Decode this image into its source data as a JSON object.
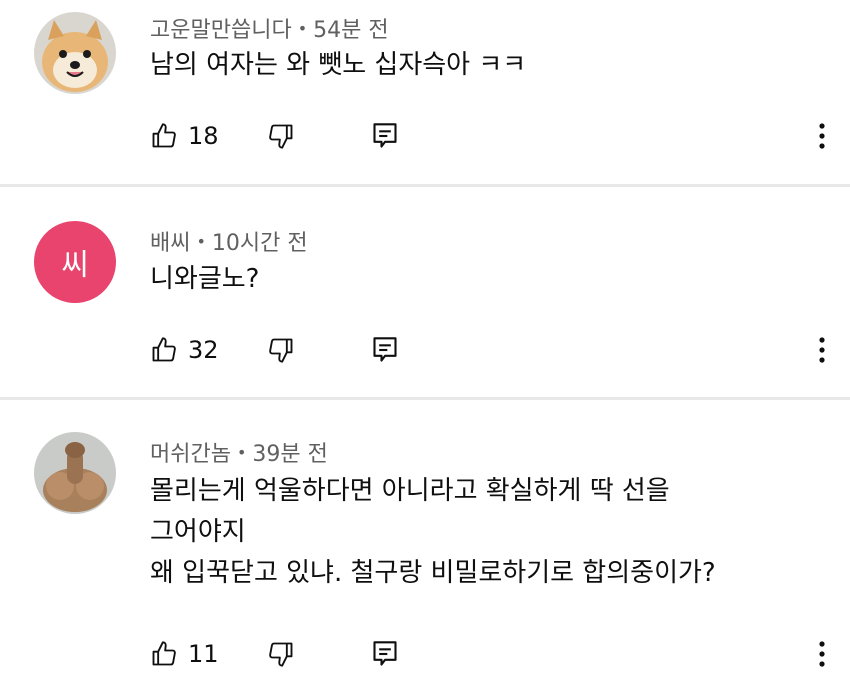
{
  "comments": [
    {
      "author": "고운말만씁니다",
      "time": "54분 전",
      "lines": [
        "남의 여자는 와 뺏노 십자슥아 ㅋㅋ"
      ],
      "likes": "18",
      "avatar": "dog-photo"
    },
    {
      "author": "배씨",
      "time": "10시간 전",
      "lines": [
        "니와글노?"
      ],
      "likes": "32",
      "avatar": "initial",
      "avatar_initial": "씨",
      "avatar_color": "#e8446d"
    },
    {
      "author": "머쉬간놈",
      "time": "39분 전",
      "lines": [
        "몰리는게 억울하다면 아니라고 확실하게 딱 선을",
        "그어야지",
        "왜 입꾹닫고 있냐. 철구랑 비밀로하기로 합의중이가?"
      ],
      "likes": "11",
      "avatar": "photo"
    }
  ],
  "icons": {
    "like": "thumbs-up-icon",
    "dislike": "thumbs-down-icon",
    "reply": "reply-icon",
    "more": "more-vertical-icon"
  },
  "separator": "•"
}
